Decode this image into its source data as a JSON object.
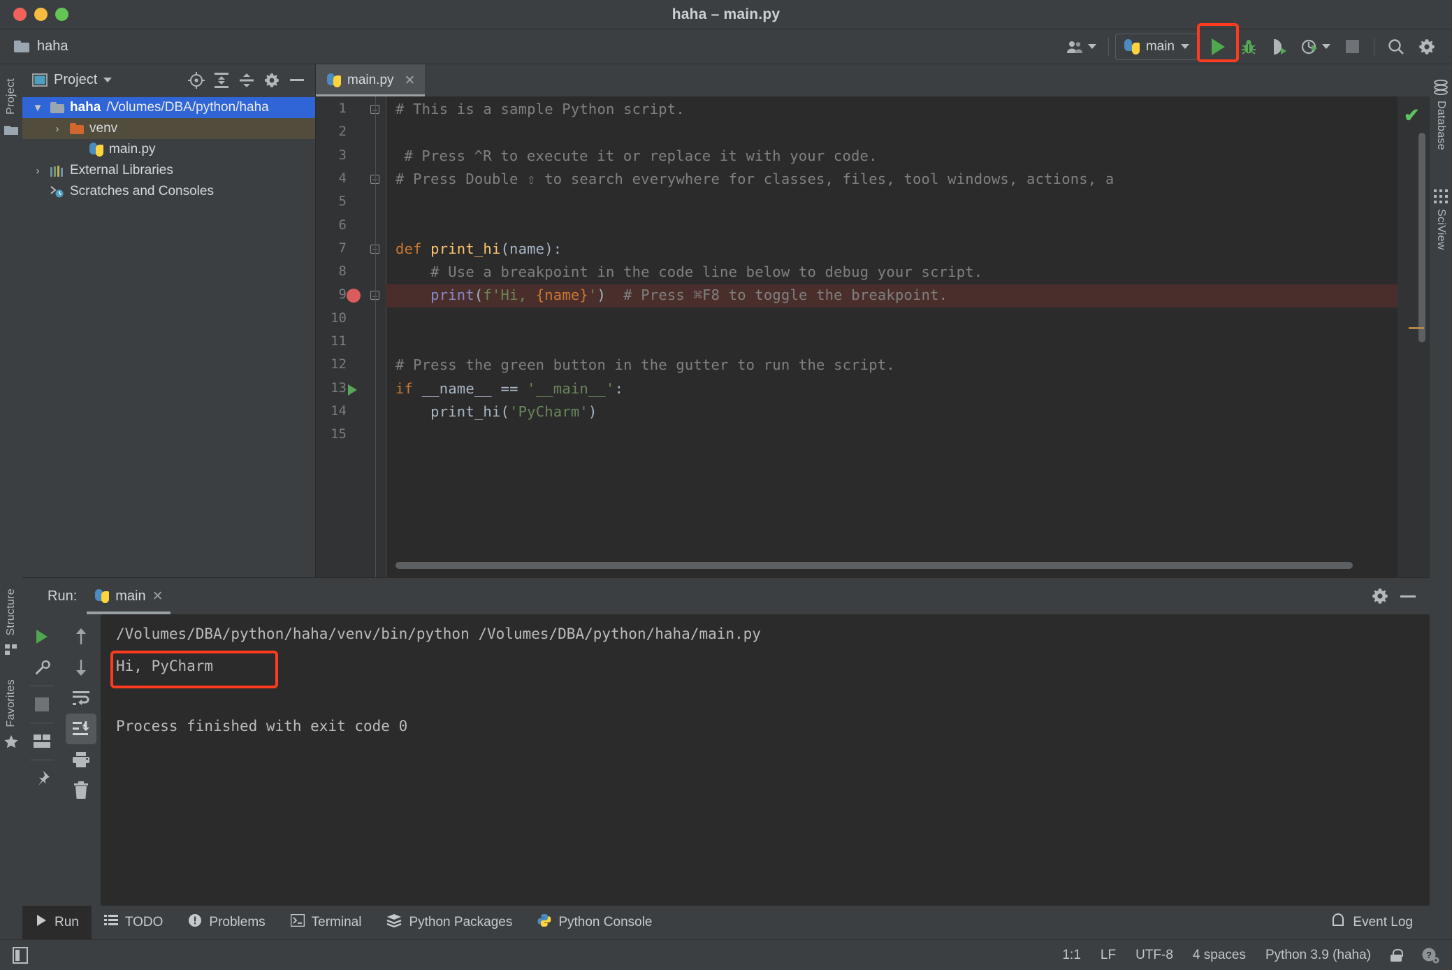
{
  "window": {
    "title": "haha – main.py",
    "traffic_lights": [
      "close",
      "minimize",
      "zoom"
    ]
  },
  "toolbar": {
    "breadcrumb": "haha",
    "run_config": {
      "label": "main",
      "icon": "python-icon"
    },
    "buttons": [
      {
        "name": "run-button",
        "icon": "play-icon",
        "highlighted": true
      },
      {
        "name": "debug-button",
        "icon": "bug-icon"
      },
      {
        "name": "run-coverage-button",
        "icon": "coverage-icon"
      },
      {
        "name": "profile-button",
        "icon": "profiler-icon"
      },
      {
        "name": "stop-button",
        "icon": "stop-icon"
      },
      {
        "name": "search-everywhere-button",
        "icon": "search-icon"
      },
      {
        "name": "settings-button",
        "icon": "gear-icon"
      }
    ],
    "accent_highlight_color": "#ff3b1f"
  },
  "left_rail": {
    "labels": [
      "Project",
      "Structure",
      "Favorites"
    ]
  },
  "right_rail": {
    "labels": [
      "Database",
      "SciView"
    ]
  },
  "project_panel": {
    "title": "Project",
    "toolbar_icons": [
      "locate-icon",
      "expand-all-icon",
      "collapse-all-icon",
      "gear-icon",
      "minimize-icon"
    ],
    "tree": [
      {
        "indent": 0,
        "arrow": "▼",
        "icon": "folder-blue-icon",
        "name": "haha",
        "path": "/Volumes/DBA/python/haha",
        "state": "selected"
      },
      {
        "indent": 1,
        "arrow": "›",
        "icon": "folder-orange-icon",
        "name": "venv",
        "path": "",
        "state": "highlighted"
      },
      {
        "indent": 2,
        "arrow": "",
        "icon": "python-file-icon",
        "name": "main.py",
        "path": "",
        "state": "normal"
      },
      {
        "indent": 0,
        "arrow": "›",
        "icon": "libraries-icon",
        "name": "External Libraries",
        "path": "",
        "state": "normal"
      },
      {
        "indent": 0,
        "arrow": "",
        "icon": "scratches-icon",
        "name": "Scratches and Consoles",
        "path": "",
        "state": "normal"
      }
    ]
  },
  "editor": {
    "tab": {
      "label": "main.py",
      "icon": "python-file-icon",
      "close": "✕"
    },
    "inspection_status": "ok-check-icon",
    "lines": [
      {
        "num": 1,
        "fold": true,
        "gutter": "",
        "tokens": [
          {
            "t": "# This is a sample Python script.",
            "c": "cm"
          }
        ],
        "indent": 0
      },
      {
        "num": 2,
        "fold": false,
        "gutter": "",
        "tokens": [],
        "indent": 0
      },
      {
        "num": 3,
        "fold": false,
        "gutter": "",
        "tokens": [
          {
            "t": "# Press ^R to execute it or replace it with your code.",
            "c": "cm"
          }
        ],
        "indent": 1
      },
      {
        "num": 4,
        "fold": true,
        "gutter": "",
        "tokens": [
          {
            "t": "# Press Double ⇧ to search everywhere for classes, files, tool windows, actions, a",
            "c": "cm"
          }
        ],
        "indent": 0
      },
      {
        "num": 5,
        "fold": false,
        "gutter": "",
        "tokens": [],
        "indent": 0
      },
      {
        "num": 6,
        "fold": false,
        "gutter": "",
        "tokens": [],
        "indent": 0
      },
      {
        "num": 7,
        "fold": true,
        "gutter": "",
        "tokens": [
          {
            "t": "def ",
            "c": "kw"
          },
          {
            "t": "print_hi",
            "c": "fn"
          },
          {
            "t": "(name):",
            "c": "pl"
          }
        ],
        "indent": 0
      },
      {
        "num": 8,
        "fold": false,
        "gutter": "",
        "tokens": [
          {
            "t": "    # Use a breakpoint in the code line below to debug your script.",
            "c": "cm"
          }
        ],
        "indent": 0
      },
      {
        "num": 9,
        "fold": true,
        "gutter": "breakpoint",
        "tokens": [
          {
            "t": "    ",
            "c": "pl"
          },
          {
            "t": "print",
            "c": "bi"
          },
          {
            "t": "(",
            "c": "pl"
          },
          {
            "t": "f'Hi, ",
            "c": "st"
          },
          {
            "t": "{name}",
            "c": "ob"
          },
          {
            "t": "'",
            "c": "st"
          },
          {
            "t": ")",
            "c": "pl"
          },
          {
            "t": "  # Press ⌘F8 to toggle the breakpoint.",
            "c": "cm"
          }
        ],
        "indent": 0,
        "highlight": true
      },
      {
        "num": 10,
        "fold": false,
        "gutter": "",
        "tokens": [],
        "indent": 0
      },
      {
        "num": 11,
        "fold": false,
        "gutter": "",
        "tokens": [],
        "indent": 0
      },
      {
        "num": 12,
        "fold": false,
        "gutter": "",
        "tokens": [
          {
            "t": "# Press the green button in the gutter to run the script.",
            "c": "cm"
          }
        ],
        "indent": 0
      },
      {
        "num": 13,
        "fold": false,
        "gutter": "run",
        "tokens": [
          {
            "t": "if ",
            "c": "kw"
          },
          {
            "t": "__name__ ",
            "c": "pl"
          },
          {
            "t": "== ",
            "c": "pl"
          },
          {
            "t": "'__main__'",
            "c": "st"
          },
          {
            "t": ":",
            "c": "pl"
          }
        ],
        "indent": 0
      },
      {
        "num": 14,
        "fold": false,
        "gutter": "",
        "tokens": [
          {
            "t": "    ",
            "c": "pl"
          },
          {
            "t": "print_hi",
            "c": "pl"
          },
          {
            "t": "(",
            "c": "pl"
          },
          {
            "t": "'PyCharm'",
            "c": "st"
          },
          {
            "t": ")",
            "c": "pl"
          }
        ],
        "indent": 0
      },
      {
        "num": 15,
        "fold": false,
        "gutter": "",
        "tokens": [],
        "indent": 0
      }
    ]
  },
  "run_panel": {
    "run_label": "Run:",
    "tab": {
      "label": "main",
      "icon": "python-icon",
      "close": "✕"
    },
    "header_icons": [
      "gear-icon",
      "minimize-icon"
    ],
    "rail_icons": [
      "rerun-icon",
      "wrench-icon",
      "stop-icon",
      "layout-icon",
      "pin-icon"
    ],
    "rail2_icons": [
      "up-arrow-icon",
      "down-arrow-icon",
      "soft-wrap-icon",
      "scroll-to-end-icon",
      "print-icon",
      "trash-icon"
    ],
    "console": {
      "command": "/Volumes/DBA/python/haha/venv/bin/python /Volumes/DBA/python/haha/main.py",
      "output": "Hi, PyCharm",
      "output_highlighted": true,
      "exit_message": "Process finished with exit code 0"
    }
  },
  "tool_tabs": [
    {
      "label": "Run",
      "icon": "play-icon",
      "selected": true
    },
    {
      "label": "TODO",
      "icon": "todo-icon",
      "selected": false
    },
    {
      "label": "Problems",
      "icon": "problems-icon",
      "selected": false
    },
    {
      "label": "Terminal",
      "icon": "terminal-icon",
      "selected": false
    },
    {
      "label": "Python Packages",
      "icon": "packages-icon",
      "selected": false
    },
    {
      "label": "Python Console",
      "icon": "python-icon",
      "selected": false
    }
  ],
  "event_log": {
    "label": "Event Log",
    "icon": "bell-icon"
  },
  "status_bar": {
    "caret": "1:1",
    "line_sep": "LF",
    "encoding": "UTF-8",
    "indent": "4 spaces",
    "interpreter": "Python 3.9 (haha)",
    "icons": [
      "lock-icon",
      "help-icon"
    ]
  }
}
